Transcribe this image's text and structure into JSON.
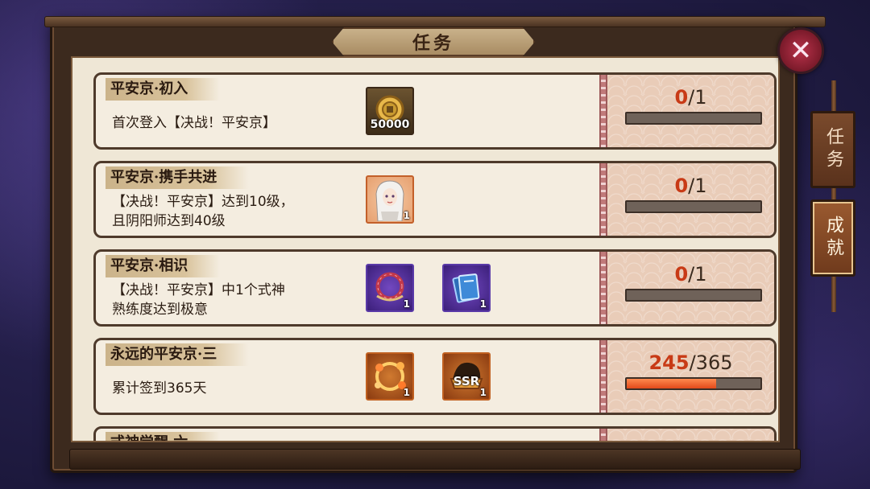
{
  "window": {
    "title": "任务"
  },
  "close": {
    "label": "✕"
  },
  "side_tabs": [
    {
      "label": "任务",
      "active": false
    },
    {
      "label": "成就",
      "active": true
    }
  ],
  "tasks": [
    {
      "title": "平安京·初入",
      "desc": [
        "首次登入【决战！平安京】"
      ],
      "rewards": [
        {
          "icon": "gold-coin-icon",
          "count": "50000",
          "style": "gold"
        }
      ],
      "progress": {
        "current": "0",
        "total": "/1",
        "fraction": 0
      }
    },
    {
      "title": "平安京·携手共进",
      "desc": [
        "【决战！平安京】达到10级，",
        "且阴阳师达到40级"
      ],
      "rewards": [
        {
          "icon": "character-portrait-icon",
          "count": "1",
          "style": "orange"
        }
      ],
      "progress": {
        "current": "0",
        "total": "/1",
        "fraction": 0
      }
    },
    {
      "title": "平安京·相识",
      "desc": [
        "【决战！平安京】中1个式神",
        "熟练度达到极意"
      ],
      "rewards": [
        {
          "icon": "frame-ring-icon",
          "count": "1",
          "style": "purple"
        },
        {
          "icon": "talisman-scroll-icon",
          "count": "1",
          "style": "purple"
        }
      ],
      "progress": {
        "current": "0",
        "total": "/1",
        "fraction": 0
      }
    },
    {
      "title": "永远的平安京·三",
      "desc": [
        "累计签到365天"
      ],
      "rewards": [
        {
          "icon": "flower-frame-icon",
          "count": "1",
          "style": "brown"
        },
        {
          "icon": "ssr-badge-icon",
          "count": "1",
          "style": "brown",
          "label": "SSR"
        }
      ],
      "progress": {
        "current": "245",
        "total": "/365",
        "fraction": 0.671
      }
    },
    {
      "title": "式神觉醒·六",
      "desc": [
        ""
      ],
      "rewards": [
        {
          "icon": "reward-item-icon",
          "count": "",
          "style": "orange"
        }
      ],
      "progress": {
        "current": "",
        "total": "",
        "fraction": 0
      }
    }
  ]
}
